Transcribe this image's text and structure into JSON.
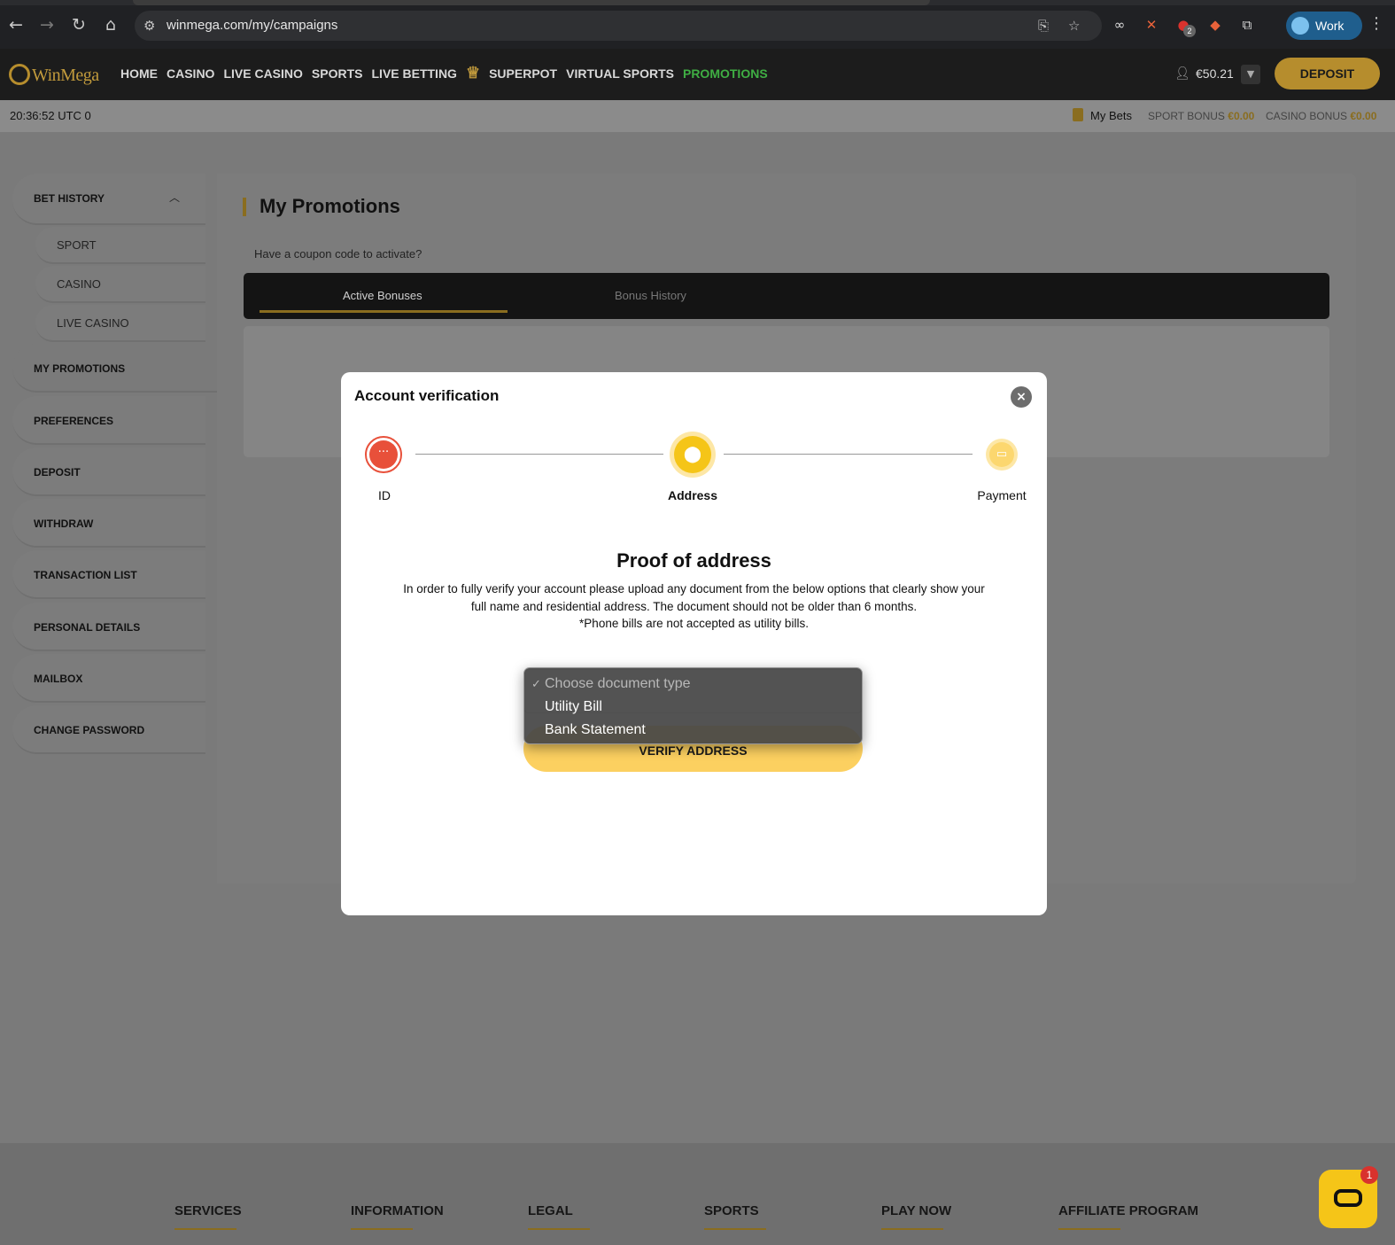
{
  "browser": {
    "url": "winmega.com/my/campaigns",
    "profile_label": "Work",
    "extension_badge": "2"
  },
  "header": {
    "logo_text": "WinMega",
    "nav": [
      "HOME",
      "CASINO",
      "LIVE CASINO",
      "SPORTS",
      "LIVE BETTING",
      "SUPERPOT",
      "VIRTUAL SPORTS",
      "PROMOTIONS"
    ],
    "balance": "€50.21",
    "deposit_label": "DEPOSIT",
    "accent_color": "#b68d2d",
    "promo_color": "#3fae43"
  },
  "subheader": {
    "clock": "20:36:52 UTC 0",
    "my_bets": "My Bets",
    "sport_bonus_label": "SPORT BONUS",
    "sport_bonus_value": "€0.00",
    "casino_bonus_label": "CASINO BONUS",
    "casino_bonus_value": "€0.00"
  },
  "sidebar": {
    "bet_history": "BET HISTORY",
    "sub_items": [
      "SPORT",
      "CASINO",
      "LIVE CASINO"
    ],
    "items": [
      "MY PROMOTIONS",
      "PREFERENCES",
      "DEPOSIT",
      "WITHDRAW",
      "TRANSACTION LIST",
      "PERSONAL DETAILS",
      "MAILBOX",
      "CHANGE PASSWORD"
    ]
  },
  "main": {
    "title": "My Promotions",
    "coupon_prompt": "Have a coupon code to activate?",
    "tabs": [
      "Active Bonuses",
      "Bonus History"
    ]
  },
  "modal": {
    "title": "Account verification",
    "steps": [
      "ID",
      "Address",
      "Payment"
    ],
    "current_step": 2,
    "proof_title": "Proof of address",
    "proof_text_1": "In order to fully verify your account please upload any document from the below options that clearly show your full name and residential address. The document should not be older than 6 months.",
    "proof_text_2": "*Phone bills are not accepted as utility bills.",
    "verify_label": "VERIFY ADDRESS",
    "dropdown_options": [
      "Choose document type",
      "Utility Bill",
      "Bank Statement"
    ],
    "selected_option": "Choose document type"
  },
  "footer": {
    "columns": [
      "SERVICES",
      "INFORMATION",
      "LEGAL",
      "SPORTS",
      "PLAY NOW",
      "AFFILIATE PROGRAM"
    ]
  },
  "chat": {
    "badge": "1"
  }
}
